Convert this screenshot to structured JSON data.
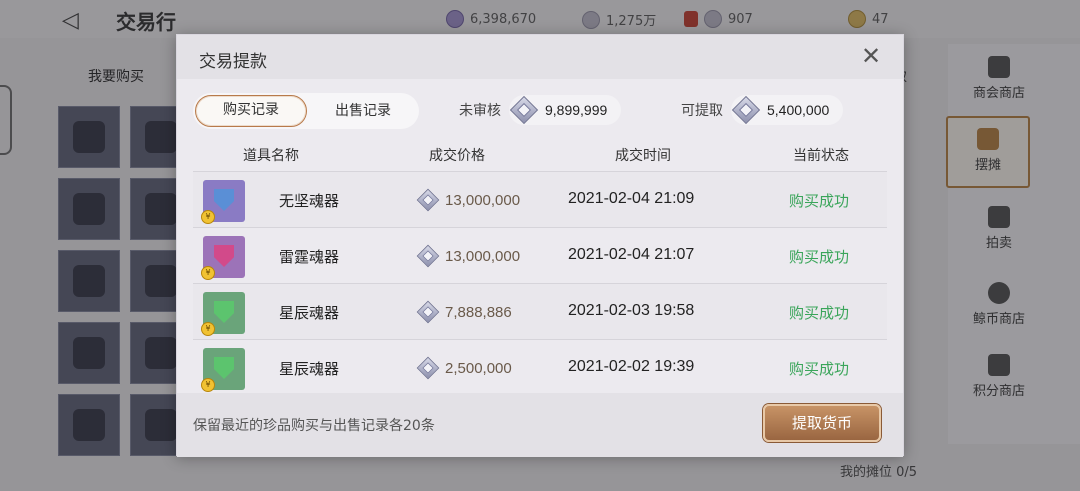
{
  "background": {
    "title": "交易行",
    "currencies": [
      {
        "icon": "purple-crystal-icon",
        "value": "6,398,670"
      },
      {
        "icon": "silver-coin-icon",
        "value": "1,275万"
      },
      {
        "icon": "silver-coin-icon",
        "value": "907"
      },
      {
        "icon": "gold-coin-icon",
        "value": "47"
      }
    ],
    "tab_buy": "我要购买",
    "side_menu": [
      "商会商店",
      "摆摊",
      "拍卖",
      "鲸币商店",
      "积分商店"
    ],
    "booth": "我的摊位 0/5",
    "partial_label": "取"
  },
  "modal": {
    "title": "交易提款",
    "tabs": {
      "buy": "购买记录",
      "sell": "出售记录"
    },
    "pending_label": "未审核",
    "pending_value": "9,899,999",
    "withdrawable_label": "可提取",
    "withdrawable_value": "5,400,000",
    "columns": [
      "道具名称",
      "成交价格",
      "成交时间",
      "当前状态"
    ],
    "rows": [
      {
        "name": "无坚魂器",
        "price": "13,000,000",
        "time": "2021-02-04 21:09",
        "status": "购买成功",
        "gem_color": "#5a8fd6",
        "bg": "#8a7bc4"
      },
      {
        "name": "雷霆魂器",
        "price": "13,000,000",
        "time": "2021-02-04 21:07",
        "status": "购买成功",
        "gem_color": "#d24a8a",
        "bg": "#9c73b8"
      },
      {
        "name": "星辰魂器",
        "price": "7,888,886",
        "time": "2021-02-03 19:58",
        "status": "购买成功",
        "gem_color": "#5cc46e",
        "bg": "#6aa47a"
      },
      {
        "name": "星辰魂器",
        "price": "2,500,000",
        "time": "2021-02-02 19:39",
        "status": "购买成功",
        "gem_color": "#5cc46e",
        "bg": "#6aa47a"
      }
    ],
    "footer_note": "保留最近的珍品购买与出售记录各20条",
    "withdraw_button": "提取货币"
  }
}
